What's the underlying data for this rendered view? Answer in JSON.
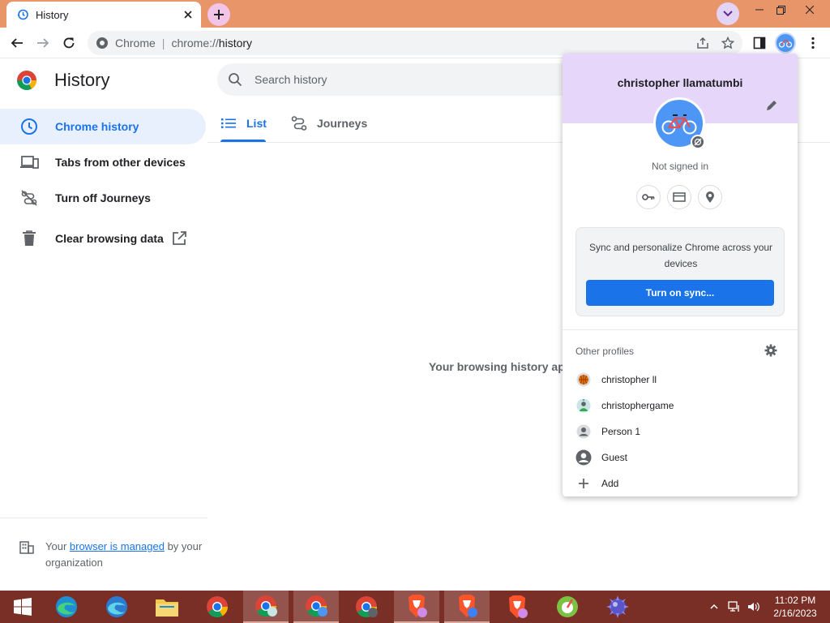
{
  "browser": {
    "tab_title": "History",
    "omnibox_scheme": "Chrome",
    "omnibox_url_prefix": "chrome://",
    "omnibox_url_host": "history"
  },
  "page": {
    "title": "History",
    "search_placeholder": "Search history",
    "sidebar": {
      "items": [
        {
          "label": "Chrome history",
          "icon": "clock-icon"
        },
        {
          "label": "Tabs from other devices",
          "icon": "devices-icon"
        },
        {
          "label": "Turn off Journeys",
          "icon": "journeys-off-icon"
        },
        {
          "label": "Clear browsing data",
          "icon": "trash-icon"
        }
      ],
      "managed_prefix": "Your ",
      "managed_link": "browser is managed",
      "managed_suffix": " by your organization"
    },
    "tabs": [
      {
        "label": "List"
      },
      {
        "label": "Journeys"
      }
    ],
    "empty_message": "Your browsing history appe"
  },
  "profile_popup": {
    "name": "christopher llamatumbi",
    "status": "Not signed in",
    "sync_text": "Sync and personalize Chrome across your devices",
    "sync_button": "Turn on sync...",
    "other_profiles_title": "Other profiles",
    "profiles": [
      {
        "label": "christopher ll",
        "icon": "basketball-avatar-icon"
      },
      {
        "label": "christophergame",
        "icon": "game-avatar-icon"
      },
      {
        "label": "Person 1",
        "icon": "person-icon"
      },
      {
        "label": "Guest",
        "icon": "guest-icon"
      },
      {
        "label": "Add",
        "icon": "plus-icon"
      }
    ],
    "header_color": "#e6d6fa",
    "avatar_color": "#4e96f5"
  },
  "taskbar": {
    "time": "11:02 PM",
    "date": "2/16/2023",
    "color": "#7a2f26"
  },
  "colors": {
    "accent": "#1a73e8",
    "titlebar": "#e9956a"
  }
}
